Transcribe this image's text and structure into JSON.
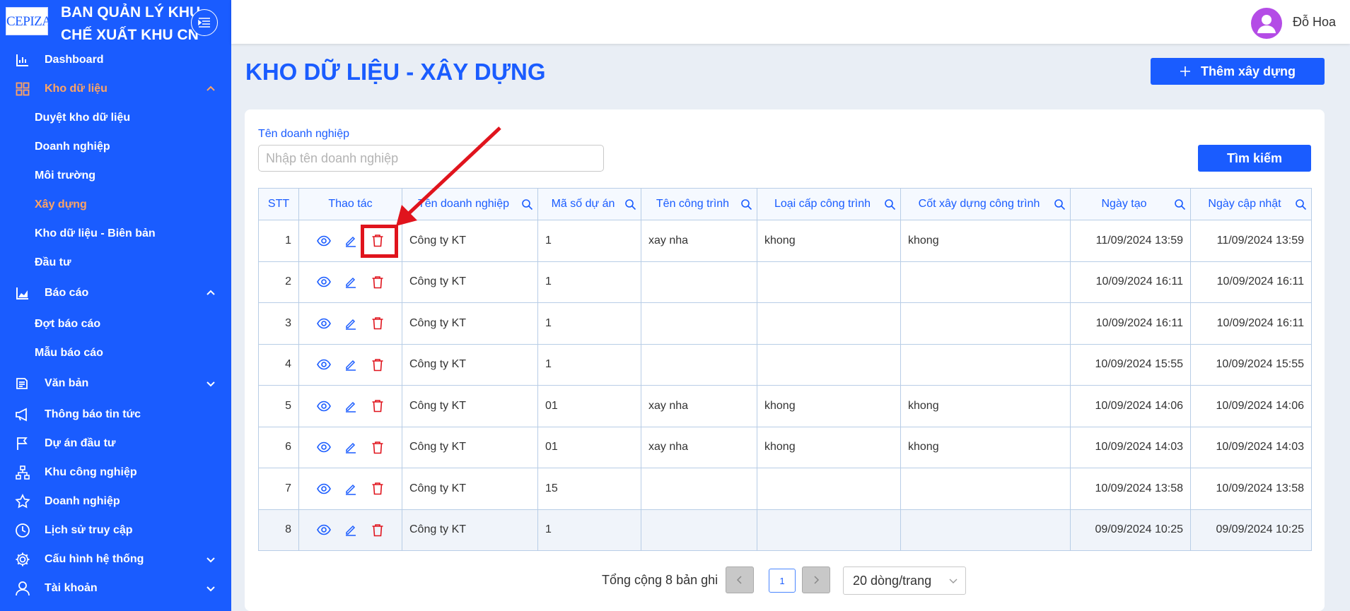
{
  "sidebar": {
    "logo_text": "CEPIZA",
    "brand_line1": "BAN QUẢN LÝ KHU",
    "brand_line2": "CHẾ XUẤT KHU CN",
    "menu": {
      "dashboard": "Dashboard",
      "kho_du_lieu": "Kho dữ liệu",
      "duyet_kho": "Duyệt kho dữ liệu",
      "doanh_nghiep_sub": "Doanh nghiệp",
      "moi_truong": "Môi trường",
      "xay_dung": "Xây dựng",
      "bien_ban": "Kho dữ liệu - Biên bản",
      "dau_tu": "Đầu tư",
      "bao_cao": "Báo cáo",
      "dot_bao_cao": "Đợt báo cáo",
      "mau_bao_cao": "Mẫu báo cáo",
      "van_ban": "Văn bản",
      "thong_bao": "Thông báo tin tức",
      "du_an": "Dự án đầu tư",
      "khu_cong_nghiep": "Khu công nghiệp",
      "doanh_nghiep": "Doanh nghiệp",
      "lich_su": "Lịch sử truy cập",
      "cau_hinh": "Cấu hình hệ thống",
      "tai_khoan": "Tài khoản"
    }
  },
  "topbar": {
    "username": "Đỗ Hoa"
  },
  "main": {
    "title": "KHO DỮ LIỆU - XÂY DỰNG",
    "add_button": "Thêm xây dựng",
    "filter_label": "Tên doanh nghiệp",
    "filter_placeholder": "Nhập tên doanh nghiệp",
    "search_button": "Tìm kiếm"
  },
  "table": {
    "headers": {
      "stt": "STT",
      "actions": "Thao tác",
      "company": "Tên doanh nghiệp",
      "project_code": "Mã số dự án",
      "work_name": "Tên công trình",
      "work_grade": "Loại cấp công trình",
      "elevation": "Cốt xây dựng công trình",
      "created": "Ngày tạo",
      "updated": "Ngày cập nhật"
    },
    "rows": [
      {
        "stt": "1",
        "company": "Công ty KT",
        "code": "1",
        "work": "xay nha",
        "grade": "khong",
        "elev": "khong",
        "created": "11/09/2024 13:59",
        "updated": "11/09/2024 13:59"
      },
      {
        "stt": "2",
        "company": "Công ty KT",
        "code": "1",
        "work": "",
        "grade": "",
        "elev": "",
        "created": "10/09/2024 16:11",
        "updated": "10/09/2024 16:11"
      },
      {
        "stt": "3",
        "company": "Công ty KT",
        "code": "1",
        "work": "",
        "grade": "",
        "elev": "",
        "created": "10/09/2024 16:11",
        "updated": "10/09/2024 16:11"
      },
      {
        "stt": "4",
        "company": "Công ty KT",
        "code": "1",
        "work": "",
        "grade": "",
        "elev": "",
        "created": "10/09/2024 15:55",
        "updated": "10/09/2024 15:55"
      },
      {
        "stt": "5",
        "company": "Công ty KT",
        "code": "01",
        "work": "xay nha",
        "grade": "khong",
        "elev": "khong",
        "created": "10/09/2024 14:06",
        "updated": "10/09/2024 14:06"
      },
      {
        "stt": "6",
        "company": "Công ty KT",
        "code": "01",
        "work": "xay nha",
        "grade": "khong",
        "elev": "khong",
        "created": "10/09/2024 14:03",
        "updated": "10/09/2024 14:03"
      },
      {
        "stt": "7",
        "company": "Công ty KT",
        "code": "15",
        "work": "",
        "grade": "",
        "elev": "",
        "created": "10/09/2024 13:58",
        "updated": "10/09/2024 13:58"
      },
      {
        "stt": "8",
        "company": "Công ty KT",
        "code": "1",
        "work": "",
        "grade": "",
        "elev": "",
        "created": "09/09/2024 10:25",
        "updated": "09/09/2024 10:25"
      }
    ]
  },
  "pagination": {
    "total_text": "Tổng cộng 8 bản ghi",
    "current_page": "1",
    "page_size": "20 dòng/trang"
  },
  "colors": {
    "primary": "#1a5cff",
    "active_menu": "#ffa463",
    "delete": "#e0141d",
    "annotation": "#e0141d"
  },
  "icons": {
    "view": "eye-icon",
    "edit": "pencil-icon",
    "delete": "trash-icon"
  }
}
